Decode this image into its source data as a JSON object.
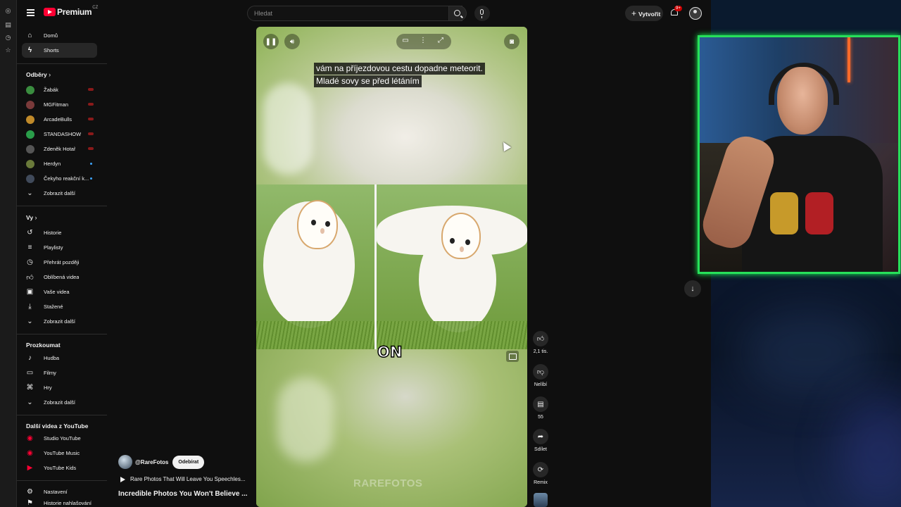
{
  "header": {
    "logo_text": "Premium",
    "region": "CZ",
    "search_placeholder": "Hledat",
    "create_label": "Vytvořit",
    "notif_badge": "9+"
  },
  "sidebar": {
    "main": [
      {
        "label": "Domů",
        "icon": "home-icon"
      },
      {
        "label": "Shorts",
        "icon": "shorts-icon"
      }
    ],
    "subs_header": "Odběry",
    "subscriptions": [
      {
        "label": "Žabák",
        "avatar_color": "#3a8d3f",
        "status": "live"
      },
      {
        "label": "MGFitman",
        "avatar_color": "#7a3a3a",
        "status": "live"
      },
      {
        "label": "ArcadeBulls",
        "avatar_color": "#c08a2a",
        "status": "live"
      },
      {
        "label": "STANDASHOW",
        "avatar_color": "#2a9d4a",
        "status": "live"
      },
      {
        "label": "Zdeněk Hotař",
        "avatar_color": "#555555",
        "status": "live"
      },
      {
        "label": "Herdyn",
        "avatar_color": "#6a7a3a",
        "status": "dot"
      },
      {
        "label": "Čekyho reakční k...",
        "avatar_color": "#404a5a",
        "status": "dot"
      }
    ],
    "subs_more": "Zobrazit další",
    "you_header": "Vy",
    "you": [
      {
        "label": "Historie",
        "icon": "history-icon"
      },
      {
        "label": "Playlisty",
        "icon": "playlists-icon"
      },
      {
        "label": "Přehrát později",
        "icon": "watch-later-icon"
      },
      {
        "label": "Oblíbená videa",
        "icon": "liked-icon"
      },
      {
        "label": "Vaše videa",
        "icon": "your-videos-icon"
      },
      {
        "label": "Stažené",
        "icon": "download-icon"
      }
    ],
    "you_more": "Zobrazit další",
    "explore_header": "Prozkoumat",
    "explore": [
      {
        "label": "Hudba",
        "icon": "music-icon"
      },
      {
        "label": "Filmy",
        "icon": "film-icon"
      },
      {
        "label": "Hry",
        "icon": "gaming-icon"
      }
    ],
    "explore_more": "Zobrazit další",
    "more_header": "Další videa z YouTube",
    "more": [
      {
        "label": "Studio YouTube",
        "icon": "studio-icon"
      },
      {
        "label": "YouTube Music",
        "icon": "yt-music-icon"
      },
      {
        "label": "YouTube Kids",
        "icon": "yt-kids-icon"
      }
    ],
    "settings_label": "Nastavení",
    "history_partial": "Historie nahlašování"
  },
  "player": {
    "caption_line1": "vám na příjezdovou cestu dopadne meteorit.",
    "caption_line2": "Mladé sovy se před létáním",
    "overlay_word": "ON",
    "watermark": "RAREFOTOS"
  },
  "actions": {
    "likes": "2,1 tis.",
    "dislike_label": "Nelíbí",
    "comments": "55",
    "share_label": "Sdílet",
    "remix_label": "Remix"
  },
  "channel": {
    "handle": "@RareFotos",
    "subscribe_label": "Odebírat",
    "playlist_title": "Rare Photos That Will Leave You Speechles...",
    "video_title": "Incredible Photos You Won't Believe ..."
  },
  "colors": {
    "accent_red": "#ff0033",
    "live_green": "#27e05a",
    "background": "#0f0f0f"
  }
}
